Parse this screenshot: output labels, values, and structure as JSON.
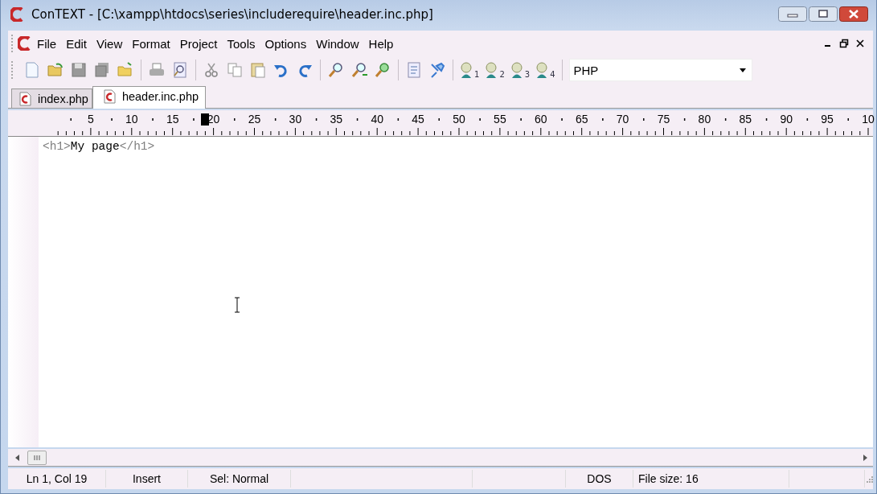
{
  "window": {
    "title": "ConTEXT - [C:\\xampp\\htdocs\\series\\includerequire\\header.inc.php]"
  },
  "menu": [
    "File",
    "Edit",
    "View",
    "Format",
    "Project",
    "Tools",
    "Options",
    "Window",
    "Help"
  ],
  "toolbar": {
    "bookmarks": [
      "1",
      "2",
      "3",
      "4"
    ],
    "highlighter": {
      "value": "PHP"
    }
  },
  "tabs": [
    {
      "label": "index.php",
      "selected": false
    },
    {
      "label": "header.inc.php",
      "selected": true
    }
  ],
  "ruler": {
    "labels": [
      "5",
      "10",
      "15",
      "20",
      "25",
      "30",
      "35",
      "40",
      "45",
      "50",
      "55",
      "60",
      "65",
      "70",
      "75",
      "80",
      "85",
      "90",
      "95",
      "10"
    ],
    "cursor": {
      "level": 0.19
    }
  },
  "editor": {
    "lines": [
      [
        {
          "kind": "tag",
          "text": "<h1>"
        },
        {
          "kind": "text",
          "text": "My page"
        },
        {
          "kind": "tag",
          "text": "</h1>"
        }
      ]
    ]
  },
  "status_bar": [
    {
      "text": "Ln 1, Col 19"
    },
    {
      "text": "Insert"
    },
    {
      "text": "Sel: Normal"
    },
    {
      "text": "DOS"
    },
    {
      "text": "File size: 16"
    }
  ]
}
